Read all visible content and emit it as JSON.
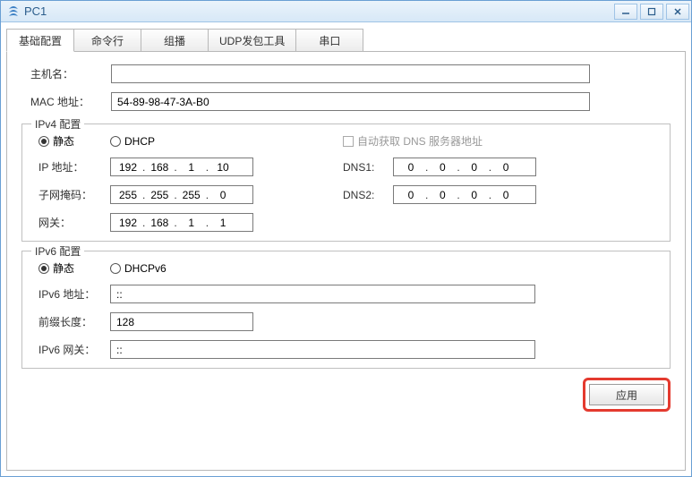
{
  "window": {
    "title": "PC1"
  },
  "tabs": {
    "basic": "基础配置",
    "cli": "命令行",
    "multicast": "组播",
    "udp": "UDP发包工具",
    "serial": "串口"
  },
  "basic": {
    "hostname_label": "主机名：",
    "hostname_value": "",
    "mac_label": "MAC 地址：",
    "mac_value": "54-89-98-47-3A-B0"
  },
  "ipv4": {
    "legend": "IPv4 配置",
    "static_label": "静态",
    "dhcp_label": "DHCP",
    "auto_dns_label": "自动获取 DNS 服务器地址",
    "ip_label": "IP 地址：",
    "ip": {
      "o1": "192",
      "o2": "168",
      "o3": "1",
      "o4": "10"
    },
    "mask_label": "子网掩码：",
    "mask": {
      "o1": "255",
      "o2": "255",
      "o3": "255",
      "o4": "0"
    },
    "gateway_label": "网关：",
    "gateway": {
      "o1": "192",
      "o2": "168",
      "o3": "1",
      "o4": "1"
    },
    "dns1_label": "DNS1:",
    "dns1": {
      "o1": "0",
      "o2": "0",
      "o3": "0",
      "o4": "0"
    },
    "dns2_label": "DNS2:",
    "dns2": {
      "o1": "0",
      "o2": "0",
      "o3": "0",
      "o4": "0"
    }
  },
  "ipv6": {
    "legend": "IPv6 配置",
    "static_label": "静态",
    "dhcp_label": "DHCPv6",
    "addr_label": "IPv6 地址：",
    "addr_value": "::",
    "prefix_label": "前缀长度：",
    "prefix_value": "128",
    "gateway_label": "IPv6 网关：",
    "gateway_value": "::"
  },
  "buttons": {
    "apply": "应用"
  }
}
